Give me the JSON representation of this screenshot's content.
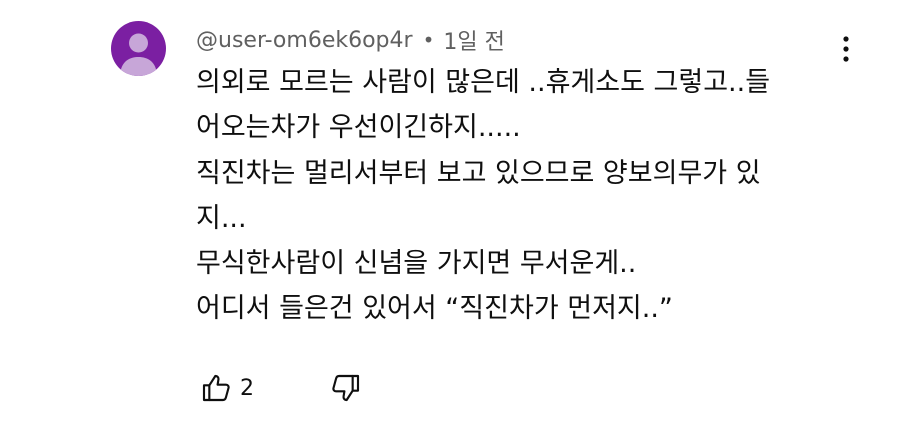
{
  "comment": {
    "author": "@user-om6ek6op4r",
    "separator": "•",
    "timestamp": "1일 전",
    "lines": [
      "의외로 모르는 사람이 많은데 ..휴게소도 그렇고..들",
      "어오는차가 우선이긴하지.....",
      "직진차는 멀리서부터 보고 있으므로 양보의무가 있",
      "지...",
      "무식한사람이 신념을 가지면 무서운게..",
      "어디서 들은건 있어서 “직진차가 먼저지..”"
    ],
    "like_count": "2"
  },
  "icons": {
    "avatar": "default-avatar-icon",
    "menu": "more-vertical-icon",
    "like": "thumbs-up-icon",
    "dislike": "thumbs-down-icon"
  },
  "colors": {
    "avatar_background": "#7b1fa2",
    "avatar_figure": "#c7a6d8",
    "text_primary": "#0f0f0f",
    "text_secondary": "#606060"
  }
}
